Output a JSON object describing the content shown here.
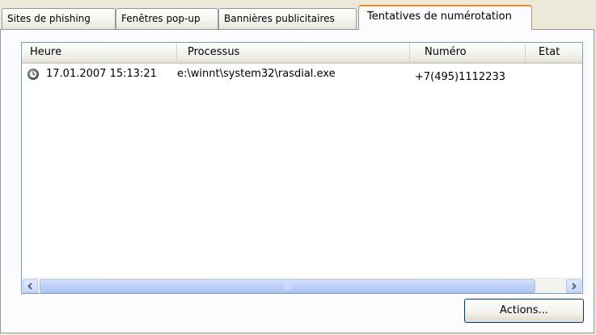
{
  "tabs": [
    {
      "label": "Sites de phishing",
      "active": false
    },
    {
      "label": "Fenêtres pop-up",
      "active": false
    },
    {
      "label": "Bannières publicitaires",
      "active": false
    },
    {
      "label": "Tentatives de numérotation",
      "active": true
    }
  ],
  "list": {
    "columns": [
      "Heure",
      "Processus",
      "Numéro",
      "Etat"
    ],
    "rows": [
      {
        "icon": "clock-icon",
        "time": "17.01.2007 15:13:21",
        "process": "e:\\winnt\\system32\\rasdial.exe",
        "number": "+7(495)1112233",
        "state": ""
      }
    ]
  },
  "buttons": {
    "actions_label": "Actions..."
  },
  "colors": {
    "active_tab_accent": "#e68b2c",
    "scrollbar_blue": "#bcd0f7",
    "window_bg": "#ece9d8"
  }
}
